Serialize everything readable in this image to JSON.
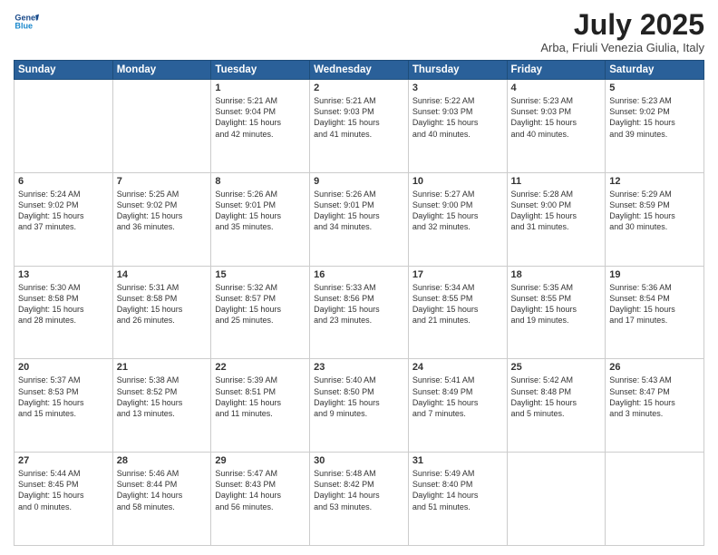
{
  "header": {
    "logo_line1": "General",
    "logo_line2": "Blue",
    "month": "July 2025",
    "location": "Arba, Friuli Venezia Giulia, Italy"
  },
  "days_of_week": [
    "Sunday",
    "Monday",
    "Tuesday",
    "Wednesday",
    "Thursday",
    "Friday",
    "Saturday"
  ],
  "weeks": [
    [
      {
        "day": "",
        "info": ""
      },
      {
        "day": "",
        "info": ""
      },
      {
        "day": "1",
        "info": "Sunrise: 5:21 AM\nSunset: 9:04 PM\nDaylight: 15 hours\nand 42 minutes."
      },
      {
        "day": "2",
        "info": "Sunrise: 5:21 AM\nSunset: 9:03 PM\nDaylight: 15 hours\nand 41 minutes."
      },
      {
        "day": "3",
        "info": "Sunrise: 5:22 AM\nSunset: 9:03 PM\nDaylight: 15 hours\nand 40 minutes."
      },
      {
        "day": "4",
        "info": "Sunrise: 5:23 AM\nSunset: 9:03 PM\nDaylight: 15 hours\nand 40 minutes."
      },
      {
        "day": "5",
        "info": "Sunrise: 5:23 AM\nSunset: 9:02 PM\nDaylight: 15 hours\nand 39 minutes."
      }
    ],
    [
      {
        "day": "6",
        "info": "Sunrise: 5:24 AM\nSunset: 9:02 PM\nDaylight: 15 hours\nand 37 minutes."
      },
      {
        "day": "7",
        "info": "Sunrise: 5:25 AM\nSunset: 9:02 PM\nDaylight: 15 hours\nand 36 minutes."
      },
      {
        "day": "8",
        "info": "Sunrise: 5:26 AM\nSunset: 9:01 PM\nDaylight: 15 hours\nand 35 minutes."
      },
      {
        "day": "9",
        "info": "Sunrise: 5:26 AM\nSunset: 9:01 PM\nDaylight: 15 hours\nand 34 minutes."
      },
      {
        "day": "10",
        "info": "Sunrise: 5:27 AM\nSunset: 9:00 PM\nDaylight: 15 hours\nand 32 minutes."
      },
      {
        "day": "11",
        "info": "Sunrise: 5:28 AM\nSunset: 9:00 PM\nDaylight: 15 hours\nand 31 minutes."
      },
      {
        "day": "12",
        "info": "Sunrise: 5:29 AM\nSunset: 8:59 PM\nDaylight: 15 hours\nand 30 minutes."
      }
    ],
    [
      {
        "day": "13",
        "info": "Sunrise: 5:30 AM\nSunset: 8:58 PM\nDaylight: 15 hours\nand 28 minutes."
      },
      {
        "day": "14",
        "info": "Sunrise: 5:31 AM\nSunset: 8:58 PM\nDaylight: 15 hours\nand 26 minutes."
      },
      {
        "day": "15",
        "info": "Sunrise: 5:32 AM\nSunset: 8:57 PM\nDaylight: 15 hours\nand 25 minutes."
      },
      {
        "day": "16",
        "info": "Sunrise: 5:33 AM\nSunset: 8:56 PM\nDaylight: 15 hours\nand 23 minutes."
      },
      {
        "day": "17",
        "info": "Sunrise: 5:34 AM\nSunset: 8:55 PM\nDaylight: 15 hours\nand 21 minutes."
      },
      {
        "day": "18",
        "info": "Sunrise: 5:35 AM\nSunset: 8:55 PM\nDaylight: 15 hours\nand 19 minutes."
      },
      {
        "day": "19",
        "info": "Sunrise: 5:36 AM\nSunset: 8:54 PM\nDaylight: 15 hours\nand 17 minutes."
      }
    ],
    [
      {
        "day": "20",
        "info": "Sunrise: 5:37 AM\nSunset: 8:53 PM\nDaylight: 15 hours\nand 15 minutes."
      },
      {
        "day": "21",
        "info": "Sunrise: 5:38 AM\nSunset: 8:52 PM\nDaylight: 15 hours\nand 13 minutes."
      },
      {
        "day": "22",
        "info": "Sunrise: 5:39 AM\nSunset: 8:51 PM\nDaylight: 15 hours\nand 11 minutes."
      },
      {
        "day": "23",
        "info": "Sunrise: 5:40 AM\nSunset: 8:50 PM\nDaylight: 15 hours\nand 9 minutes."
      },
      {
        "day": "24",
        "info": "Sunrise: 5:41 AM\nSunset: 8:49 PM\nDaylight: 15 hours\nand 7 minutes."
      },
      {
        "day": "25",
        "info": "Sunrise: 5:42 AM\nSunset: 8:48 PM\nDaylight: 15 hours\nand 5 minutes."
      },
      {
        "day": "26",
        "info": "Sunrise: 5:43 AM\nSunset: 8:47 PM\nDaylight: 15 hours\nand 3 minutes."
      }
    ],
    [
      {
        "day": "27",
        "info": "Sunrise: 5:44 AM\nSunset: 8:45 PM\nDaylight: 15 hours\nand 0 minutes."
      },
      {
        "day": "28",
        "info": "Sunrise: 5:46 AM\nSunset: 8:44 PM\nDaylight: 14 hours\nand 58 minutes."
      },
      {
        "day": "29",
        "info": "Sunrise: 5:47 AM\nSunset: 8:43 PM\nDaylight: 14 hours\nand 56 minutes."
      },
      {
        "day": "30",
        "info": "Sunrise: 5:48 AM\nSunset: 8:42 PM\nDaylight: 14 hours\nand 53 minutes."
      },
      {
        "day": "31",
        "info": "Sunrise: 5:49 AM\nSunset: 8:40 PM\nDaylight: 14 hours\nand 51 minutes."
      },
      {
        "day": "",
        "info": ""
      },
      {
        "day": "",
        "info": ""
      }
    ]
  ]
}
